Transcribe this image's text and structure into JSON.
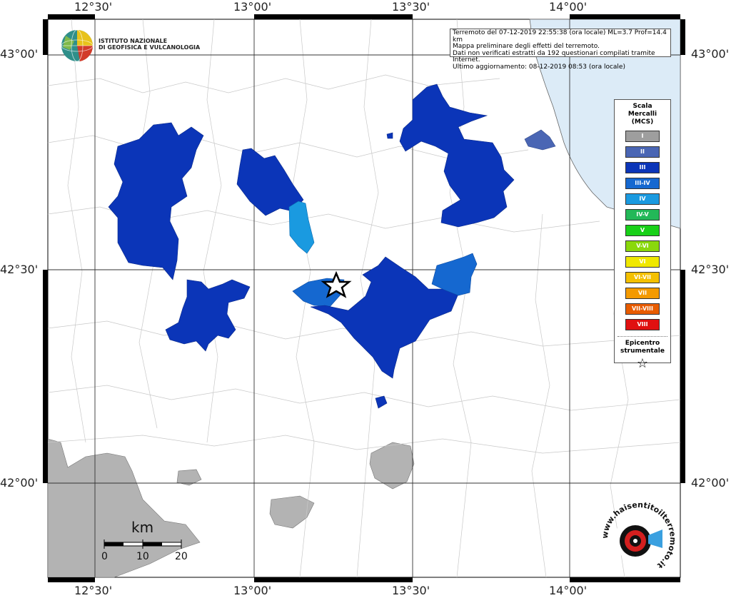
{
  "map": {
    "grid": {
      "lon_labels": [
        "12°30'",
        "13°00'",
        "13°30'",
        "14°00'"
      ],
      "lat_labels": [
        "43°00'",
        "42°30'",
        "42°00'"
      ]
    },
    "info_lines": [
      "Terremoto del 07-12-2019 22:55:38 (ora locale) ML=3.7 Prof=14.4 km",
      "Mappa preliminare degli effetti del terremoto.",
      "Dati non verificati estratti da 192 questionari compilati tramite Internet.",
      "Ultimo aggiornamento: 08-12-2019 08:53 (ora locale)"
    ],
    "ingv": {
      "line1": "ISTITUTO NAZIONALE",
      "line2": "DI GEOFISICA E VULCANOLOGIA"
    },
    "legend": {
      "title_lines": [
        "Scala",
        "Mercalli",
        "(MCS)"
      ],
      "levels": [
        {
          "label": "I",
          "color": "#9e9e9e"
        },
        {
          "label": "II",
          "color": "#4a66b4"
        },
        {
          "label": "III",
          "color": "#0b35b8"
        },
        {
          "label": "III-IV",
          "color": "#1568d0"
        },
        {
          "label": "IV",
          "color": "#1a9ae0"
        },
        {
          "label": "IV-V",
          "color": "#23b858"
        },
        {
          "label": "V",
          "color": "#18d018"
        },
        {
          "label": "V-VI",
          "color": "#8ad80c"
        },
        {
          "label": "VI",
          "color": "#f0e800"
        },
        {
          "label": "VI-VII",
          "color": "#f4c000"
        },
        {
          "label": "VII",
          "color": "#f49a00"
        },
        {
          "label": "VII-VIII",
          "color": "#e85c00"
        },
        {
          "label": "VIII",
          "color": "#e01010"
        }
      ],
      "epicentre_lines": [
        "Epicentro",
        "strumentale"
      ]
    },
    "scale_bar": {
      "unit": "km",
      "ticks": [
        "0",
        "10",
        "20"
      ]
    },
    "hsit_logo_text": "www.haisentitoilterremoto.it"
  }
}
